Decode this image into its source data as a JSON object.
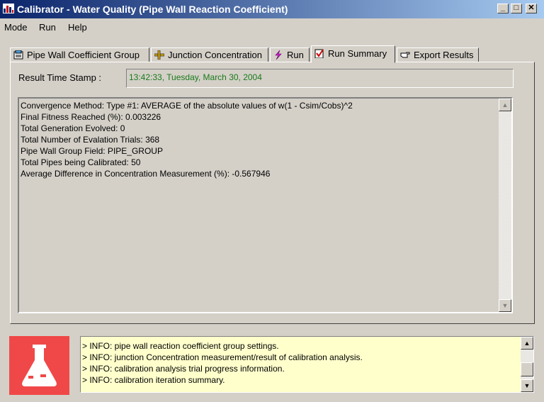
{
  "window": {
    "title": "Calibrator - Water Quality (Pipe Wall Reaction Coefficient)",
    "app_icon": "calibrator-app-icon",
    "controls": {
      "minimize": "_",
      "maximize": "□",
      "close": "✕"
    },
    "colors": {
      "titlebar_start": "#0a246a",
      "titlebar_end": "#a6caf0",
      "face": "#d4d0c8"
    }
  },
  "menu": [
    "Mode",
    "Run",
    "Help"
  ],
  "tabs": [
    {
      "label": "Pipe Wall Coefficient Group",
      "icon": "pipe-group-icon"
    },
    {
      "label": "Junction Concentration",
      "icon": "junction-icon"
    },
    {
      "label": "Run",
      "icon": "lightning-icon"
    },
    {
      "label": "Run Summary",
      "icon": "checklist-icon",
      "active": true
    },
    {
      "label": "Export Results",
      "icon": "pointing-hand-icon"
    }
  ],
  "timestamp": {
    "label": "Result Time Stamp :",
    "value": "13:42:33, Tuesday, March 30, 2004",
    "value_color": "#1a7a1a"
  },
  "summary_lines": [
    "Convergence Method: Type #1: AVERAGE of the absolute values of w(1 - Csim/Cobs)^2",
    "Final Fitness Reached (%): 0.003226",
    "Total Generation Evolved: 0",
    "Total Number of Evalation Trials: 368",
    "Pipe Wall Group Field: PIPE_GROUP",
    "Total Pipes being Calibrated: 50",
    "Average Difference in Concentration Measurement (%): -0.567946"
  ],
  "log": {
    "background": "#ffffcc",
    "lines": [
      "> INFO: pipe wall reaction coefficient group settings.",
      "> INFO: junction Concentration measurement/result of calibration analysis.",
      "> INFO: calibration analysis trial progress information.",
      "> INFO: calibration iteration summary."
    ]
  },
  "status_icon": {
    "name": "flask-icon",
    "color": "#f04848"
  }
}
